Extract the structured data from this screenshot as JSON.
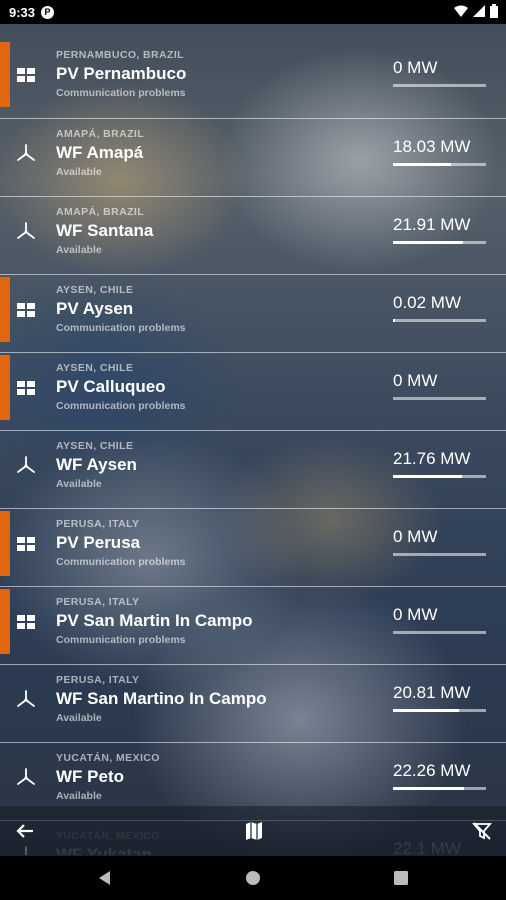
{
  "status_bar": {
    "time": "9:33",
    "notification_glyph": "P"
  },
  "sites": [
    {
      "location": "PERNAMBUCO, BRAZIL",
      "name": "PV Pernambuco",
      "status": "Communication problems",
      "power": "0 MW",
      "type": "pv",
      "alert": true,
      "level": 0.0
    },
    {
      "location": "AMAPÁ, BRAZIL",
      "name": "WF Amapá",
      "status": "Available",
      "power": "18.03 MW",
      "type": "wind",
      "alert": false,
      "level": 0.62
    },
    {
      "location": "AMAPÁ, BRAZIL",
      "name": "WF Santana",
      "status": "Available",
      "power": "21.91 MW",
      "type": "wind",
      "alert": false,
      "level": 0.75
    },
    {
      "location": "AYSEN, CHILE",
      "name": "PV Aysen",
      "status": "Communication problems",
      "power": "0.02 MW",
      "type": "pv",
      "alert": true,
      "level": 0.02
    },
    {
      "location": "AYSEN, CHILE",
      "name": "PV Calluqueo",
      "status": "Communication problems",
      "power": "0 MW",
      "type": "pv",
      "alert": true,
      "level": 0.0
    },
    {
      "location": "AYSEN, CHILE",
      "name": "WF Aysen",
      "status": "Available",
      "power": "21.76 MW",
      "type": "wind",
      "alert": false,
      "level": 0.74
    },
    {
      "location": "PERUSA, ITALY",
      "name": "PV Perusa",
      "status": "Communication problems",
      "power": "0 MW",
      "type": "pv",
      "alert": true,
      "level": 0.0
    },
    {
      "location": "PERUSA, ITALY",
      "name": "PV San Martin In Campo",
      "status": "Communication problems",
      "power": "0 MW",
      "type": "pv",
      "alert": true,
      "level": 0.0
    },
    {
      "location": "PERUSA, ITALY",
      "name": "WF San Martino In Campo",
      "status": "Available",
      "power": "20.81 MW",
      "type": "wind",
      "alert": false,
      "level": 0.71
    },
    {
      "location": "YUCATÁN, MEXICO",
      "name": "WF Peto",
      "status": "Available",
      "power": "22.26 MW",
      "type": "wind",
      "alert": false,
      "level": 0.76
    },
    {
      "location": "YUCATÁN, MEXICO",
      "name": "WF Yukatan",
      "status": "",
      "power": "22.1 MW",
      "type": "wind",
      "alert": false,
      "level": 0.75
    }
  ],
  "toolbar": {
    "back_icon": "arrow-left-icon",
    "map_icon": "map-icon",
    "filter_icon": "filter-off-icon"
  },
  "colors": {
    "alert": "#e0660f",
    "bar_fill": "#ffffff"
  }
}
